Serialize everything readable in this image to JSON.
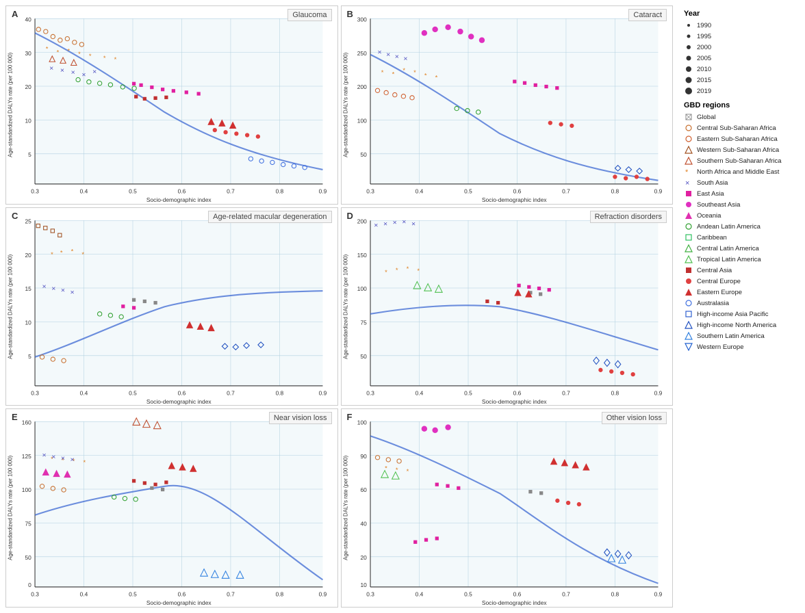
{
  "panels": [
    {
      "id": "A",
      "title": "Glaucoma",
      "yLabel": "Age-standardized DALYs rate (per 100 000)",
      "xLabel": "Socio-demographic index",
      "yRange": [
        5,
        40
      ],
      "xRange": [
        0.25,
        0.9
      ]
    },
    {
      "id": "B",
      "title": "Cataract",
      "yLabel": "Age-standardized DALYs rate (per 100 000)",
      "xLabel": "Socio-demographic index",
      "yRange": [
        0,
        300
      ],
      "xRange": [
        0.25,
        0.9
      ]
    },
    {
      "id": "C",
      "title": "Age-related macular degeneration",
      "yLabel": "Age-standardized DALYs rate (per 100 000)",
      "xLabel": "Socio-demographic index",
      "yRange": [
        0,
        25
      ],
      "xRange": [
        0.25,
        0.9
      ]
    },
    {
      "id": "D",
      "title": "Refraction disorders",
      "yLabel": "Age-standardized DALYs rate (per 100 000)",
      "xLabel": "Socio-demographic index",
      "yRange": [
        50,
        200
      ],
      "xRange": [
        0.25,
        0.9
      ]
    },
    {
      "id": "E",
      "title": "Near vision loss",
      "yLabel": "Age-standardized DALYs rate (per 100 000)",
      "xLabel": "Socio-demographic index",
      "yRange": [
        0,
        160
      ],
      "xRange": [
        0.25,
        0.9
      ]
    },
    {
      "id": "F",
      "title": "Other vision loss",
      "yLabel": "Age-standardized DALYs rate (per 100 000)",
      "xLabel": "Socio-demographic index",
      "yRange": [
        10,
        100
      ],
      "xRange": [
        0.25,
        0.9
      ]
    }
  ],
  "legend": {
    "year_title": "Year",
    "years": [
      {
        "label": "1990",
        "size": 3
      },
      {
        "label": "1995",
        "size": 4
      },
      {
        "label": "2000",
        "size": 5
      },
      {
        "label": "2005",
        "size": 6
      },
      {
        "label": "2010",
        "size": 7
      },
      {
        "label": "2015",
        "size": 8
      },
      {
        "label": "2019",
        "size": 9
      }
    ],
    "regions_title": "GBD regions",
    "regions": [
      {
        "label": "Global",
        "symbol": "⊠",
        "color": "#888"
      },
      {
        "label": "Central Sub-Saharan Africa",
        "symbol": "○",
        "color": "#c87030"
      },
      {
        "label": "Eastern Sub-Saharan Africa",
        "symbol": "○",
        "color": "#d06030"
      },
      {
        "label": "Western Sub-Saharan Africa",
        "symbol": "◇",
        "color": "#a05020"
      },
      {
        "label": "Southern Sub-Saharan Africa",
        "symbol": "△",
        "color": "#c05030"
      },
      {
        "label": "North Africa and Middle East",
        "symbol": "✳",
        "color": "#e08020"
      },
      {
        "label": "South Asia",
        "symbol": "×",
        "color": "#5050c0"
      },
      {
        "label": "East Asia",
        "symbol": "■",
        "color": "#e020a0"
      },
      {
        "label": "Southeast Asia",
        "symbol": "●",
        "color": "#e030c0"
      },
      {
        "label": "Oceania",
        "symbol": "▲",
        "color": "#e030b0"
      },
      {
        "label": "Andean Latin America",
        "symbol": "○",
        "color": "#30a030"
      },
      {
        "label": "Caribbean",
        "symbol": "□",
        "color": "#30c060"
      },
      {
        "label": "Central Latin America",
        "symbol": "◇",
        "color": "#40b040"
      },
      {
        "label": "Tropical Latin America",
        "symbol": "△",
        "color": "#50c050"
      },
      {
        "label": "Central Asia",
        "symbol": "■",
        "color": "#c03030"
      },
      {
        "label": "Central Europe",
        "symbol": "●",
        "color": "#e04040"
      },
      {
        "label": "Eastern Europe",
        "symbol": "▲",
        "color": "#d03030"
      },
      {
        "label": "Australasia",
        "symbol": "○",
        "color": "#4070e0"
      },
      {
        "label": "High-income Asia Pacific",
        "symbol": "□",
        "color": "#3060d0"
      },
      {
        "label": "High-income North America",
        "symbol": "◇",
        "color": "#2050c0"
      },
      {
        "label": "Southern Latin America",
        "symbol": "△",
        "color": "#3080e0"
      },
      {
        "label": "Western Europe",
        "symbol": "▽",
        "color": "#2060d0"
      }
    ]
  }
}
